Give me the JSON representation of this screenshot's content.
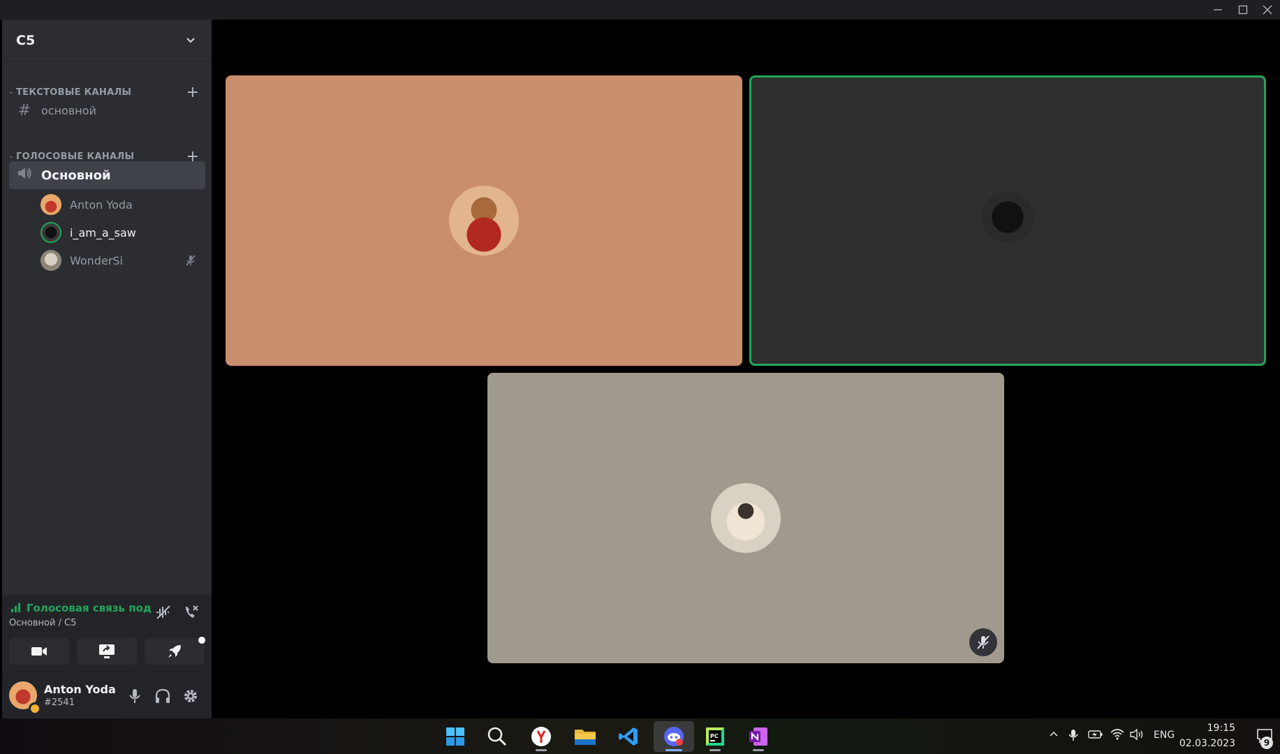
{
  "server": {
    "name": "C5"
  },
  "categories": {
    "text": {
      "label": "ТЕКСТОВЫЕ КАНАЛЫ"
    },
    "voice": {
      "label": "ГОЛОСОВЫЕ КАНАЛЫ"
    }
  },
  "text_channels": [
    {
      "label": "основной"
    }
  ],
  "voice_channels": [
    {
      "label": "Основной",
      "active": true
    }
  ],
  "voice_users": [
    {
      "name": "Anton Yoda",
      "speaking": false,
      "muted": false
    },
    {
      "name": "i_am_a_saw",
      "speaking": true,
      "muted": false
    },
    {
      "name": "WonderSi",
      "speaking": false,
      "muted": true
    }
  ],
  "voice_panel": {
    "status": "Голосовая связь под",
    "location": "Основной / C5",
    "status_color": "#23a55a"
  },
  "user_panel": {
    "name": "Anton Yoda",
    "tag": "#2541"
  },
  "tiles": [
    {
      "user": "Anton Yoda",
      "background": "#c98e6c",
      "speaking": false
    },
    {
      "user": "i_am_a_saw",
      "background": "#2f2f2f",
      "speaking": true
    },
    {
      "user": "WonderSi",
      "background": "#a0998d",
      "speaking": false,
      "muted": true
    }
  ],
  "taskbar": {
    "apps": [
      "start-icon",
      "search-icon",
      "yandex-browser-icon",
      "file-explorer-icon",
      "vscode-icon",
      "discord-icon",
      "pycharm-icon",
      "onenote-icon"
    ],
    "language": "ENG",
    "time": "19:15",
    "date": "02.03.2023",
    "notifications": "9"
  },
  "accent_colors": {
    "speaking": "#23a55a",
    "sidebar": "#2b2d31",
    "panel": "#232428"
  }
}
